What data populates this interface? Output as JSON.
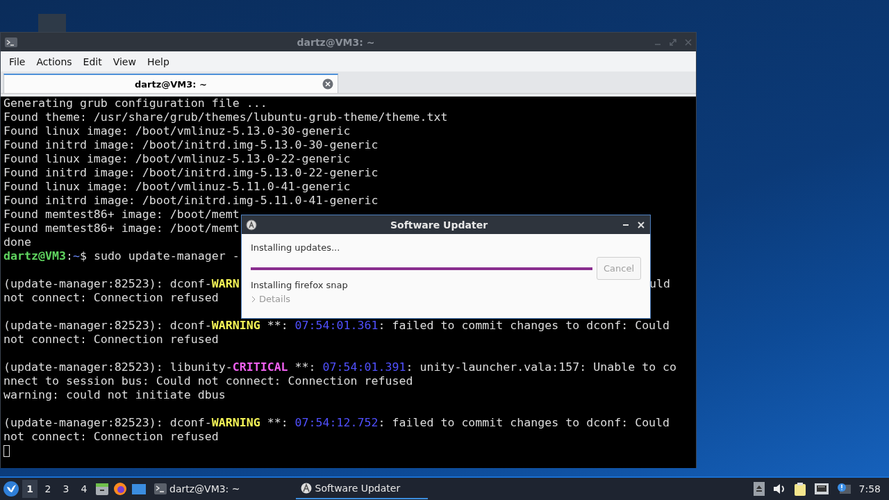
{
  "terminal": {
    "title": "dartz@VM3: ~",
    "menu": [
      "File",
      "Actions",
      "Edit",
      "View",
      "Help"
    ],
    "tabs": [
      {
        "label": "dartz@VM3: ~",
        "selected": true
      }
    ],
    "lines": [
      {
        "kind": "text",
        "segments": [
          {
            "kind": "plain",
            "text": "Generating grub configuration file ..."
          }
        ]
      },
      {
        "kind": "text",
        "segments": [
          {
            "kind": "plain",
            "text": "Found theme: /usr/share/grub/themes/lubuntu-grub-theme/theme.txt"
          }
        ]
      },
      {
        "kind": "text",
        "segments": [
          {
            "kind": "plain",
            "text": "Found linux image: /boot/vmlinuz-5.13.0-30-generic"
          }
        ]
      },
      {
        "kind": "text",
        "segments": [
          {
            "kind": "plain",
            "text": "Found initrd image: /boot/initrd.img-5.13.0-30-generic"
          }
        ]
      },
      {
        "kind": "text",
        "segments": [
          {
            "kind": "plain",
            "text": "Found linux image: /boot/vmlinuz-5.13.0-22-generic"
          }
        ]
      },
      {
        "kind": "text",
        "segments": [
          {
            "kind": "plain",
            "text": "Found initrd image: /boot/initrd.img-5.13.0-22-generic"
          }
        ]
      },
      {
        "kind": "text",
        "segments": [
          {
            "kind": "plain",
            "text": "Found linux image: /boot/vmlinuz-5.11.0-41-generic"
          }
        ]
      },
      {
        "kind": "text",
        "segments": [
          {
            "kind": "plain",
            "text": "Found initrd image: /boot/initrd.img-5.11.0-41-generic"
          }
        ]
      },
      {
        "kind": "text",
        "segments": [
          {
            "kind": "plain",
            "text": "Found memtest86+ image: /boot/memt"
          }
        ]
      },
      {
        "kind": "text",
        "segments": [
          {
            "kind": "plain",
            "text": "Found memtest86+ image: /boot/memt"
          }
        ]
      },
      {
        "kind": "text",
        "segments": [
          {
            "kind": "plain",
            "text": "done"
          }
        ]
      },
      {
        "kind": "text",
        "segments": [
          {
            "kind": "user",
            "text": "dartz@VM3"
          },
          {
            "kind": "plain",
            "text": ":"
          },
          {
            "kind": "path",
            "text": "~"
          },
          {
            "kind": "plain",
            "text": "$ sudo update-manager -"
          }
        ]
      },
      {
        "kind": "blank"
      },
      {
        "kind": "text",
        "segments": [
          {
            "kind": "plain",
            "text": "(update-manager:82523): dconf-"
          },
          {
            "kind": "warning",
            "text": "WARN"
          }
        ],
        "right": "uld"
      },
      {
        "kind": "text",
        "segments": [
          {
            "kind": "plain",
            "text": "not connect: Connection refused"
          }
        ]
      },
      {
        "kind": "blank"
      },
      {
        "kind": "text",
        "segments": [
          {
            "kind": "plain",
            "text": "(update-manager:82523): dconf-"
          },
          {
            "kind": "warning",
            "text": "WARNING"
          },
          {
            "kind": "plain",
            "text": " **: "
          },
          {
            "kind": "time",
            "text": "07:54:01.361"
          },
          {
            "kind": "plain",
            "text": ": failed to commit changes to dconf: Could"
          }
        ]
      },
      {
        "kind": "text",
        "segments": [
          {
            "kind": "plain",
            "text": "not connect: Connection refused"
          }
        ]
      },
      {
        "kind": "blank"
      },
      {
        "kind": "text",
        "segments": [
          {
            "kind": "plain",
            "text": "(update-manager:82523): libunity-"
          },
          {
            "kind": "critical",
            "text": "CRITICAL"
          },
          {
            "kind": "plain",
            "text": " **: "
          },
          {
            "kind": "time",
            "text": "07:54:01.391"
          },
          {
            "kind": "plain",
            "text": ": unity-launcher.vala:157: Unable to co"
          }
        ]
      },
      {
        "kind": "text",
        "segments": [
          {
            "kind": "plain",
            "text": "nnect to session bus: Could not connect: Connection refused"
          }
        ]
      },
      {
        "kind": "text",
        "segments": [
          {
            "kind": "plain",
            "text": "warning: could not initiate dbus"
          }
        ]
      },
      {
        "kind": "blank"
      },
      {
        "kind": "text",
        "segments": [
          {
            "kind": "plain",
            "text": "(update-manager:82523): dconf-"
          },
          {
            "kind": "warning",
            "text": "WARNING"
          },
          {
            "kind": "plain",
            "text": " **: "
          },
          {
            "kind": "time",
            "text": "07:54:12.752"
          },
          {
            "kind": "plain",
            "text": ": failed to commit changes to dconf: Could"
          }
        ]
      },
      {
        "kind": "text",
        "segments": [
          {
            "kind": "plain",
            "text": "not connect: Connection refused"
          }
        ]
      }
    ]
  },
  "dialog": {
    "title": "Software Updater",
    "status": "Installing updates...",
    "progress": {
      "level": 1
    },
    "detail": "Installing firefox snap",
    "expander": {
      "label": "Details",
      "expanded": false
    },
    "button": {
      "label": "Cancel",
      "disabled": true
    }
  },
  "taskbar": {
    "desktops": [
      {
        "label": "1",
        "selected": true
      },
      {
        "label": "2",
        "selected": false
      },
      {
        "label": "3",
        "selected": false
      },
      {
        "label": "4",
        "selected": false
      }
    ],
    "tasks": [
      {
        "label": "dartz@VM3: ~",
        "kind": "terminal",
        "selected": false
      },
      {
        "label": "Software Updater",
        "kind": "updater",
        "selected": true
      }
    ],
    "clock": "7:58"
  }
}
